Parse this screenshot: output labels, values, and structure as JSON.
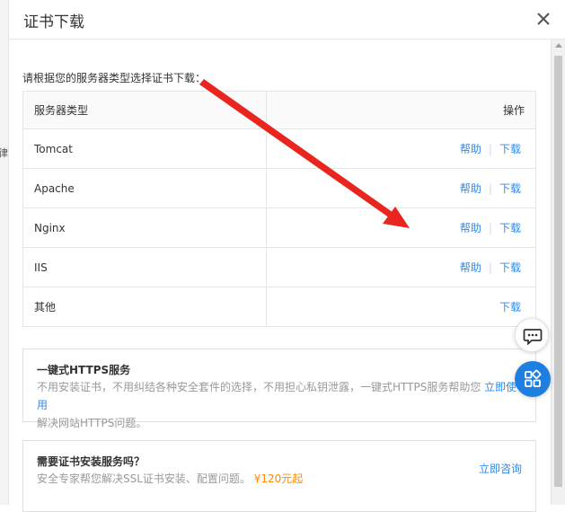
{
  "dialog": {
    "title": "证书下载",
    "intro": "请根据您的服务器类型选择证书下载："
  },
  "table": {
    "col_server": "服务器类型",
    "col_ops": "操作",
    "rows": [
      {
        "name": "Tomcat",
        "help": "帮助",
        "download": "下载"
      },
      {
        "name": "Apache",
        "help": "帮助",
        "download": "下载"
      },
      {
        "name": "Nginx",
        "help": "帮助",
        "download": "下载"
      },
      {
        "name": "IIS",
        "help": "帮助",
        "download": "下载"
      },
      {
        "name": "其他",
        "download": "下载"
      }
    ]
  },
  "https_card": {
    "title": "一键式HTTPS服务",
    "desc_line1": "不用安装证书，不用纠结各种安全套件的选择，不用担心私钥泄露，一键式HTTPS服务帮助您",
    "action": "立即使用",
    "desc_line2": "解决网站HTTPS问题。"
  },
  "install_card": {
    "title": "需要证书安装服务吗？",
    "desc": "安全专家帮您解决SSL证书安装、配置问题。",
    "price": "¥120元起",
    "action": "立即咨询"
  },
  "left_edge_glyph": "律",
  "colors": {
    "link": "#2d8cf0",
    "price": "#ff8a00",
    "annotation_arrow": "#e8261f",
    "float_button": "#1f7fe0"
  },
  "icons": {
    "close": "close-icon",
    "chat": "chat-icon",
    "apps": "apps-grid-icon"
  }
}
